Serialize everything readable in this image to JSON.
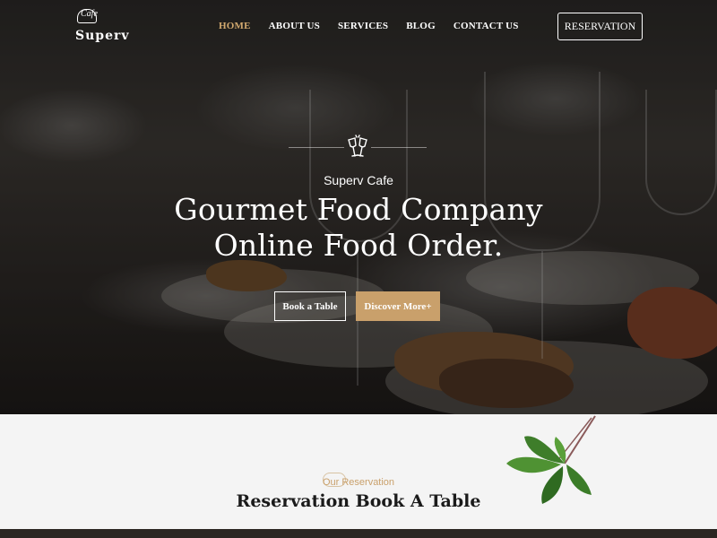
{
  "brand": {
    "logo_top": "Cafe",
    "logo_name": "Superv"
  },
  "nav": {
    "items": [
      {
        "label": "HOME",
        "active": true
      },
      {
        "label": "ABOUT US",
        "active": false
      },
      {
        "label": "SERVICES",
        "active": false
      },
      {
        "label": "BLOG",
        "active": false
      },
      {
        "label": "CONTACT US",
        "active": false
      }
    ],
    "reservation_button": "RESERVATION"
  },
  "hero": {
    "icon": "cheers-glasses-icon",
    "tagline": "Superv Cafe",
    "headline_line1": "Gourmet Food Company",
    "headline_line2": "Online Food Order.",
    "primary_button": "Book a Table",
    "secondary_button": "Discover More+"
  },
  "reservation_section": {
    "kicker": "Our Reservation",
    "title": "Reservation Book A Table",
    "decor_icon": "basil-leaf-icon"
  },
  "colors": {
    "accent": "#c9a06b",
    "active_nav": "#d2a96f",
    "section_bg": "#f4f4f4"
  }
}
